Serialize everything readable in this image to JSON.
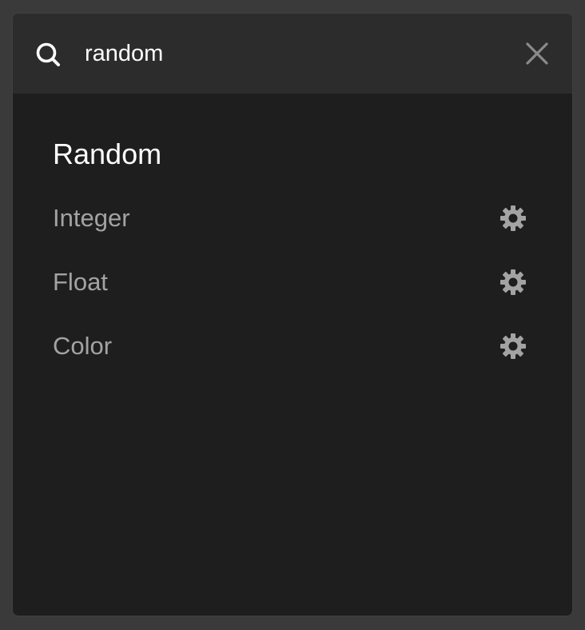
{
  "search": {
    "value": "random",
    "icon": "search-icon",
    "close_icon": "close-icon"
  },
  "results": {
    "group_title": "Random",
    "items": [
      {
        "label": "Integer",
        "icon": "gear-icon"
      },
      {
        "label": "Float",
        "icon": "gear-icon"
      },
      {
        "label": "Color",
        "icon": "gear-icon"
      }
    ]
  },
  "colors": {
    "background": "#3a3a3a",
    "panel": "#1e1e1e",
    "search_bar": "#2c2c2c",
    "title_text": "#ffffff",
    "item_text": "#a3a3a3",
    "icon": "#a3a3a3"
  }
}
